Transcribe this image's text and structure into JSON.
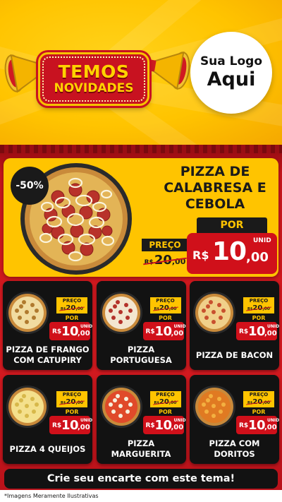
{
  "header": {
    "badge_line1": "TEMOS",
    "badge_line2": "NOVIDADES",
    "logo_line1": "Sua Logo",
    "logo_line2": "Aqui"
  },
  "colors": {
    "yellow": "#ffc400",
    "red": "#d0101a",
    "dark": "#121212"
  },
  "feature": {
    "discount": "-50%",
    "title": "PIZZA DE CALABRESA E CEBOLA",
    "preco_label": "PREÇO",
    "old_currency": "R$",
    "old_int": "20",
    "old_dec": ",00",
    "por_label": "POR",
    "unid_label": "UNID",
    "new_currency": "R$",
    "new_int": "10",
    "new_dec": ",00"
  },
  "products": [
    {
      "name": "PIZZA DE FRANGO COM CATUPIRY",
      "preco_label": "PREÇO",
      "old_currency": "R$",
      "old_int": "20",
      "old_dec": ",00",
      "por_label": "POR",
      "unid_label": "UNID",
      "new_currency": "R$",
      "new_int": "10",
      "new_dec": ",00",
      "icon": "pizza-frango-icon"
    },
    {
      "name": "PIZZA PORTUGUESA",
      "preco_label": "PREÇO",
      "old_currency": "R$",
      "old_int": "20",
      "old_dec": ",00",
      "por_label": "POR",
      "unid_label": "UNID",
      "new_currency": "R$",
      "new_int": "10",
      "new_dec": ",00",
      "icon": "pizza-portuguesa-icon"
    },
    {
      "name": "PIZZA DE BACON",
      "preco_label": "PREÇO",
      "old_currency": "R$",
      "old_int": "20",
      "old_dec": ",00",
      "por_label": "POR",
      "unid_label": "UNID",
      "new_currency": "R$",
      "new_int": "10",
      "new_dec": ",00",
      "icon": "pizza-bacon-icon"
    },
    {
      "name": "PIZZA 4 QUEIJOS",
      "preco_label": "PREÇO",
      "old_currency": "R$",
      "old_int": "20",
      "old_dec": ",00",
      "por_label": "POR",
      "unid_label": "UNID",
      "new_currency": "R$",
      "new_int": "10",
      "new_dec": ",00",
      "icon": "pizza-4-queijos-icon"
    },
    {
      "name": "PIZZA MARGUERITA",
      "preco_label": "PREÇO",
      "old_currency": "R$",
      "old_int": "20",
      "old_dec": ",00",
      "por_label": "POR",
      "unid_label": "UNID",
      "new_currency": "R$",
      "new_int": "10",
      "new_dec": ",00",
      "icon": "pizza-marguerita-icon"
    },
    {
      "name": "PIZZA COM DORITOS",
      "preco_label": "PREÇO",
      "old_currency": "R$",
      "old_int": "20",
      "old_dec": ",00",
      "por_label": "POR",
      "unid_label": "UNID",
      "new_currency": "R$",
      "new_int": "10",
      "new_dec": ",00",
      "icon": "pizza-doritos-icon"
    }
  ],
  "footer": {
    "cta": "Crie seu encarte com este tema!",
    "disclaimer": "*Imagens Meramente Ilustrativas"
  }
}
